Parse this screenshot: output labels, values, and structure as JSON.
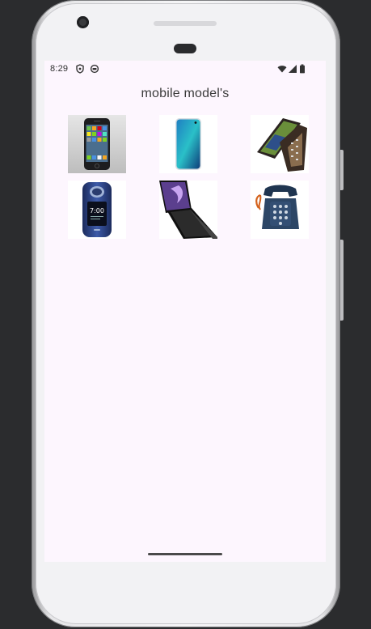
{
  "status_bar": {
    "time": "8:29",
    "icons": [
      "shield-icon",
      "circle-status-icon",
      "wifi-icon",
      "signal-icon",
      "battery-icon"
    ]
  },
  "app": {
    "title": "mobile model's"
  },
  "models": [
    {
      "icon": "iphone-image"
    },
    {
      "icon": "galaxy-s10-image"
    },
    {
      "icon": "flip-smartphone-image"
    },
    {
      "icon": "blue-flip-phone-image"
    },
    {
      "icon": "galaxy-z-flip-image"
    },
    {
      "icon": "rotary-telephone-image"
    }
  ],
  "colors": {
    "screen_background": "#fdf6fe",
    "title_text": "#3b3b3b",
    "device_frame": "#f2f2f4"
  }
}
